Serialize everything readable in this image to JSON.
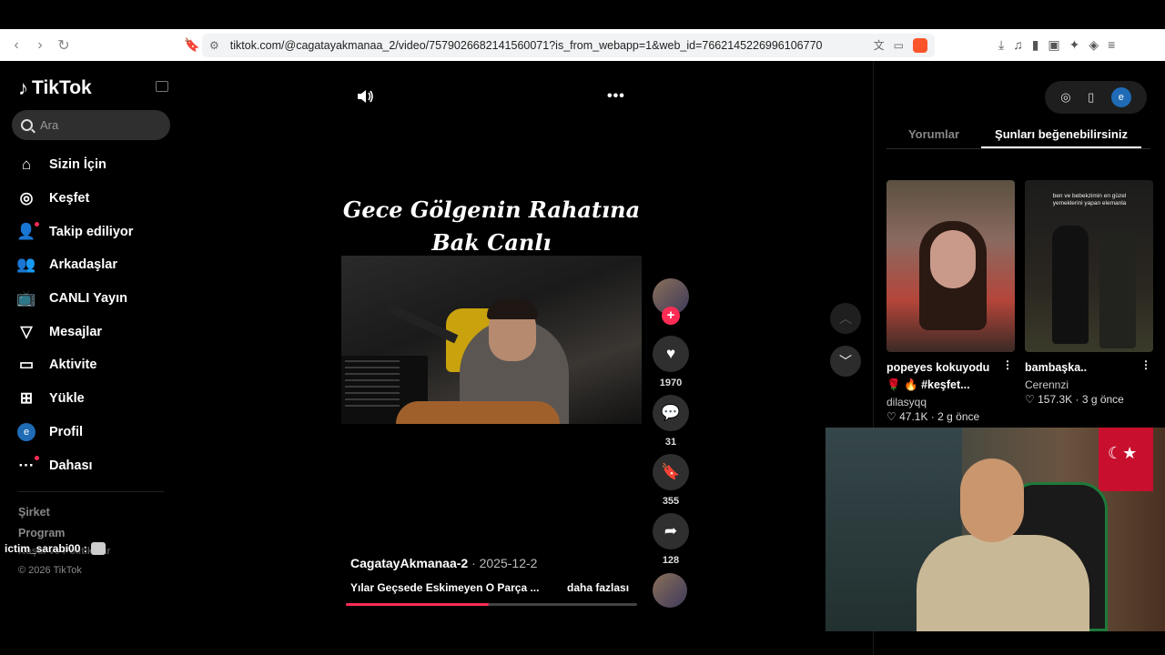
{
  "browser": {
    "url": "tiktok.com/@cagatayakmanaa_2/video/7579026682141560071?is_from_webapp=1&web_id=7662145226996106770"
  },
  "sidebar": {
    "logo": "TikTok",
    "search_placeholder": "Ara",
    "items": [
      {
        "label": "Sizin İçin",
        "icon": "home-icon"
      },
      {
        "label": "Keşfet",
        "icon": "compass-icon"
      },
      {
        "label": "Takip ediliyor",
        "icon": "user-follow-icon"
      },
      {
        "label": "Arkadaşlar",
        "icon": "friends-icon"
      },
      {
        "label": "CANLI Yayın",
        "icon": "live-tv-icon"
      },
      {
        "label": "Mesajlar",
        "icon": "send-icon"
      },
      {
        "label": "Aktivite",
        "icon": "activity-icon"
      },
      {
        "label": "Yükle",
        "icon": "upload-plus-icon"
      },
      {
        "label": "Profil",
        "icon": "profile-avatar",
        "avatar_letter": "e"
      },
      {
        "label": "Dahası",
        "icon": "more-dots-icon"
      }
    ],
    "footer": {
      "company": "Şirket",
      "program": "Program",
      "terms": "Koşul ve Politikalar",
      "copyright": "© 2026 TikTok"
    }
  },
  "chat_overlay": "ictim_sarabi00 :",
  "video": {
    "overlay_title_line1": "Gece Gölgenin Rahatına",
    "overlay_title_line2": "Bak Canlı",
    "author": "CagatayAkmanaa-2",
    "date": "· 2025-12-2",
    "description": "Yılar Geçsede Eskimeyen O Parça ...",
    "more_label": "daha fazlası",
    "progress": 0.49,
    "likes": "1970",
    "comments": "31",
    "saves": "355",
    "shares": "128"
  },
  "right_panel": {
    "avatar_letter": "e",
    "tabs": [
      "Yorumlar",
      "Şunları beğenebilirsiniz"
    ],
    "active_tab": "Şunları beğenebilirsiniz",
    "cards": [
      {
        "title": "popeyes kokuyodu 🌹 🔥 #keşfet...",
        "user": "dilasyqq",
        "likes": "47.1K",
        "age": "2 g önce"
      },
      {
        "title": "bambaşka..",
        "user": "Cerennzi",
        "likes": "157.3K",
        "age": "3 g önce",
        "caption": "ben ve bebekzimin en güzel yemeklerini yapan elemanla"
      }
    ]
  },
  "colors": {
    "accent": "#fe2c55",
    "background": "#000000",
    "avatar_blue": "#1f6bb5"
  }
}
